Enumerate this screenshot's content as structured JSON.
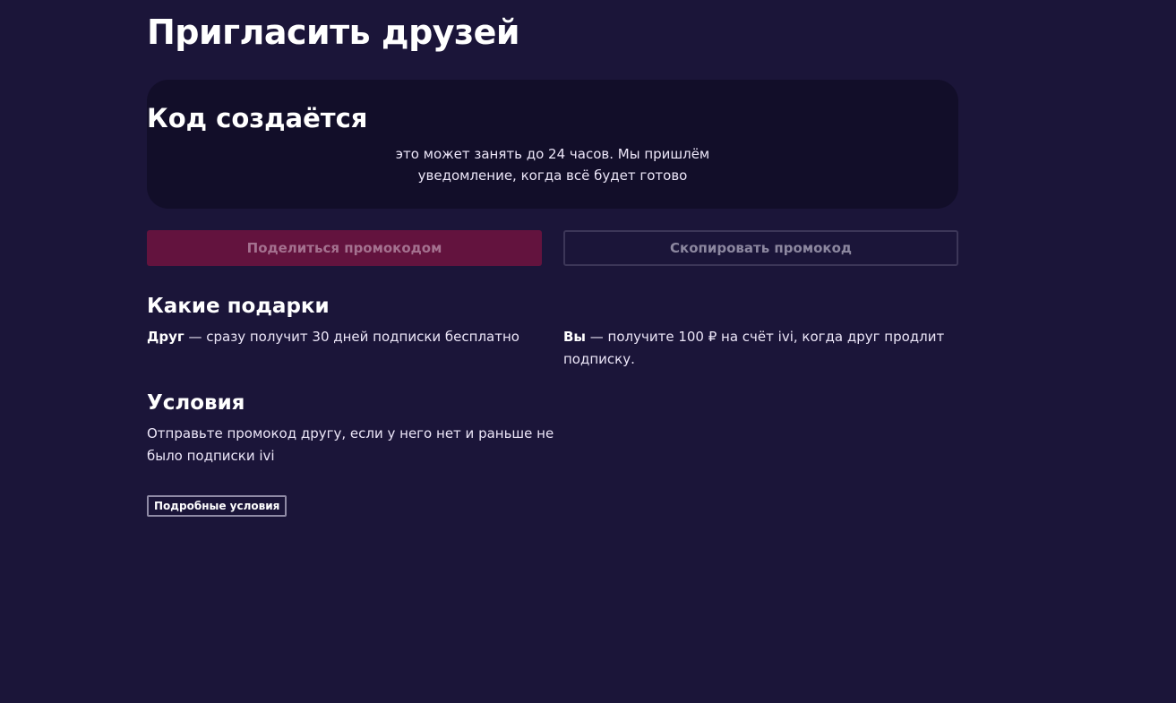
{
  "page": {
    "title": "Пригласить друзей"
  },
  "status_card": {
    "title": "Код создаётся",
    "text": "это может занять до 24 часов. Мы пришлём уведомление, когда всё будет готово"
  },
  "actions": {
    "share_label": "Поделиться промокодом",
    "copy_label": "Скопировать промокод"
  },
  "gifts": {
    "title": "Какие подарки",
    "friend": {
      "label": "Друг",
      "text": " — сразу получит 30 дней подписки бесплатно"
    },
    "you": {
      "label": "Вы",
      "text": " — получите 100 ₽ на счёт ivi, когда друг продлит подписку."
    }
  },
  "terms": {
    "title": "Условия",
    "text": "Отправьте промокод другу, если у него нет и раньше не было подписки ivi",
    "details_label": "Подробные условия"
  },
  "colors": {
    "background": "#1b1539",
    "card": "#120e29",
    "share_button": "#63133e",
    "copy_button_border": "#3c3658"
  }
}
